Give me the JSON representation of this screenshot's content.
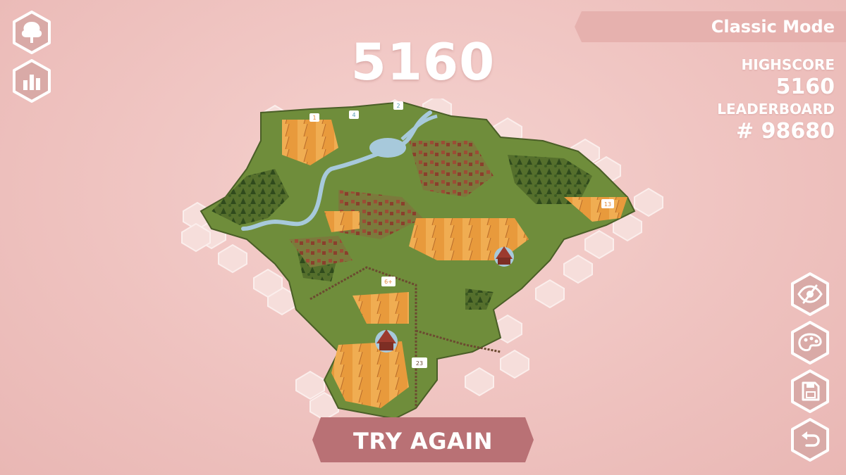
{
  "game": {
    "score": "5160",
    "mode": "Classic Mode",
    "highscore_label": "HIGHSCORE",
    "highscore_value": "5160",
    "leaderboard_label": "LEADERBOARD",
    "leaderboard_value": "# 98680",
    "try_again_label": "TRY AGAIN"
  },
  "left_buttons": [
    {
      "icon": "tree-icon"
    },
    {
      "icon": "bar-chart-icon"
    }
  ],
  "right_buttons": [
    {
      "icon": "eye-hide-icon"
    },
    {
      "icon": "palette-icon"
    },
    {
      "icon": "save-icon"
    },
    {
      "icon": "undo-icon"
    }
  ],
  "map_markers": [
    "1",
    "2",
    "4",
    "13",
    "6+",
    "23"
  ],
  "colors": {
    "background": "#f0c7c4",
    "button_fill": "#d9aaa7",
    "button_border": "#ffffff",
    "banner": "#e6b1ae",
    "try_again": "#b96f72",
    "grass": "#6e8a3a",
    "forest": "#3f5a23",
    "field": "#e89a3c",
    "water": "#9fc3d6",
    "empty_hex": "#f5dcd9"
  }
}
